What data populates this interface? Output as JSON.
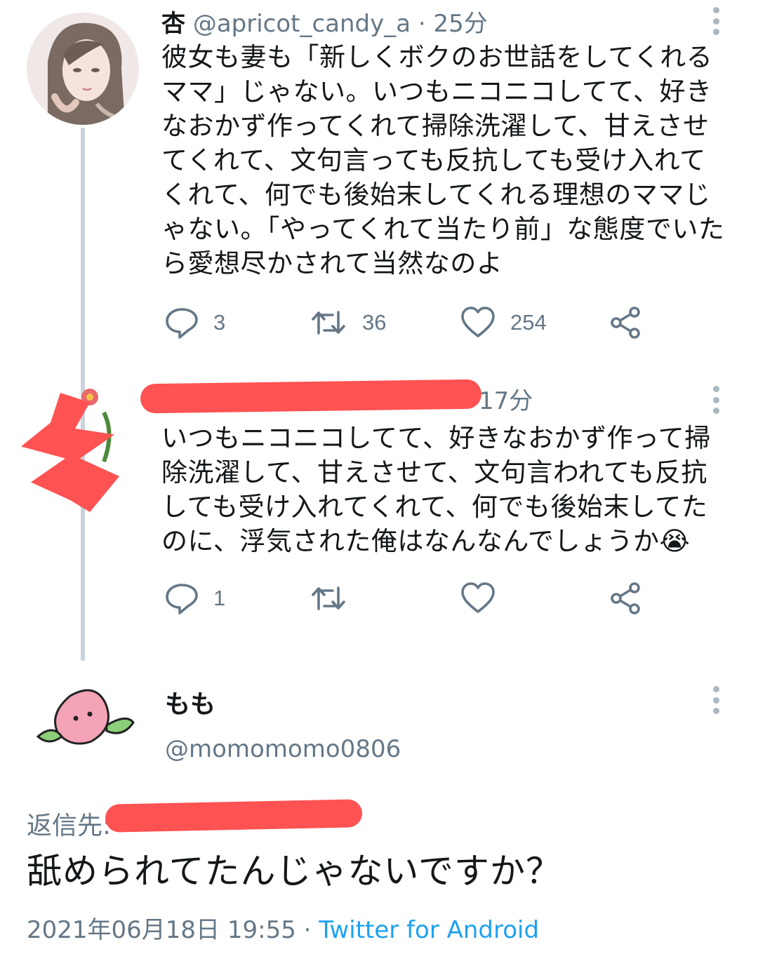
{
  "tweet1": {
    "name": "杏",
    "handle": "@apricot_candy_a",
    "time": "25分",
    "text": "彼女も妻も「新しくボクのお世話をしてくれるママ」じゃない。いつもニコニコしてて、好きなおかず作ってくれて掃除洗濯して、甘えさせてくれて、文句言っても反抗しても受け入れてくれて、何でも後始末してくれる理想のママじゃない。「やってくれて当たり前」な態度でいたら愛想尽かされて当然なのよ",
    "replies": "3",
    "retweets": "36",
    "likes": "254"
  },
  "tweet2": {
    "time": "17分",
    "text": "いつもニコニコしてて、好きなおかず作って掃除洗濯して、甘えさせて、文句言われても反抗しても受け入れてくれて、何でも後始末してたのに、浮気された俺はなんなんでしょうか😭",
    "replies": "1",
    "retweets": "",
    "likes": ""
  },
  "main_tweet": {
    "name": "もも",
    "handle": "@momomomo0806",
    "reply_to": "返信先:",
    "text": "舐められてたんじゃないですか？",
    "datetime": "2021年06月18日 19:55",
    "separator": " · ",
    "client": "Twitter for Android"
  },
  "icons": [
    "more-vertical-icon",
    "reply-icon",
    "retweet-icon",
    "like-icon",
    "share-icon"
  ],
  "colors": {
    "text": "#14171a",
    "secondary": "#657786",
    "icon": "#657786",
    "link": "#1da1f2",
    "thread_line": "#c9d3dc",
    "redaction": "#ff5252"
  }
}
